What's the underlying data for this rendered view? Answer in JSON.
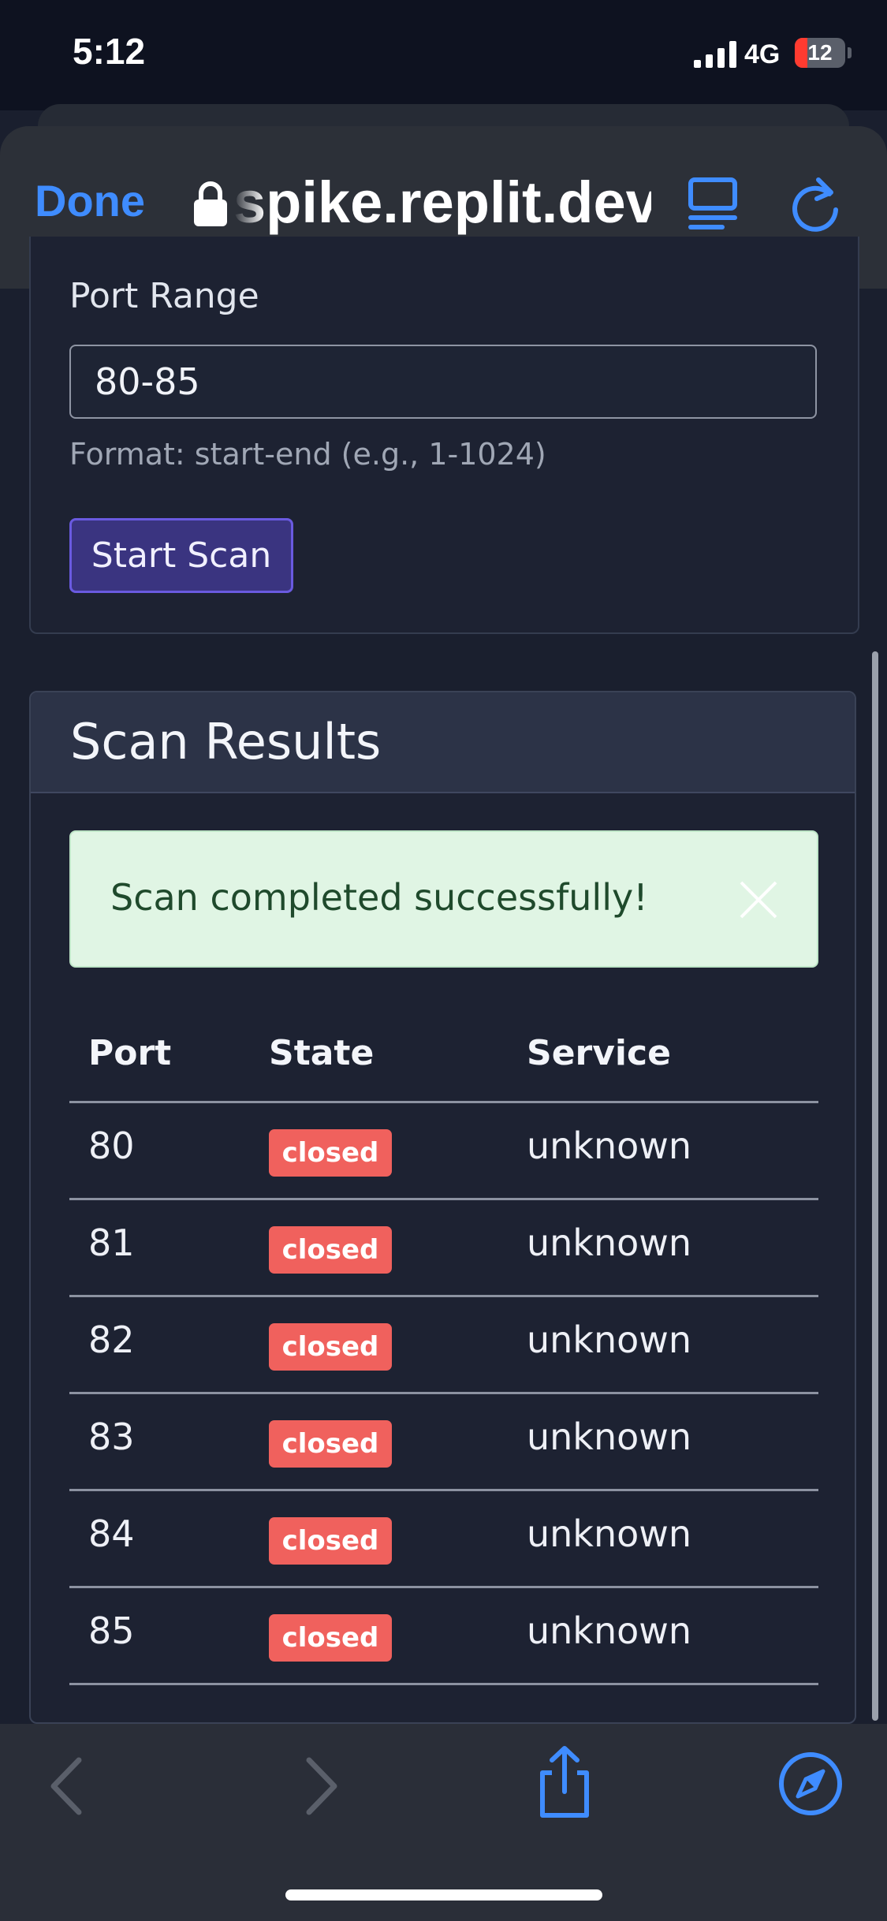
{
  "status_bar": {
    "time": "5:12",
    "network": "4G",
    "battery_level": "12"
  },
  "browser": {
    "done_label": "Done",
    "url": "spike.replit.dev",
    "accent_color": "#3f8cff"
  },
  "form": {
    "port_range_label": "Port Range",
    "port_range_value": "80-85",
    "format_hint": "Format: start-end (e.g., 1-1024)",
    "start_scan_label": "Start Scan"
  },
  "results": {
    "title": "Scan Results",
    "alert_message": "Scan completed successfully!",
    "columns": [
      "Port",
      "State",
      "Service"
    ],
    "rows": [
      {
        "port": "80",
        "state": "closed",
        "service": "unknown"
      },
      {
        "port": "81",
        "state": "closed",
        "service": "unknown"
      },
      {
        "port": "82",
        "state": "closed",
        "service": "unknown"
      },
      {
        "port": "83",
        "state": "closed",
        "service": "unknown"
      },
      {
        "port": "84",
        "state": "closed",
        "service": "unknown"
      },
      {
        "port": "85",
        "state": "closed",
        "service": "unknown"
      }
    ],
    "closed_badge_color": "#f0615d"
  },
  "toolbar": {
    "icons": [
      "back-arrow-icon",
      "forward-arrow-icon",
      "share-icon",
      "compass-icon"
    ]
  }
}
